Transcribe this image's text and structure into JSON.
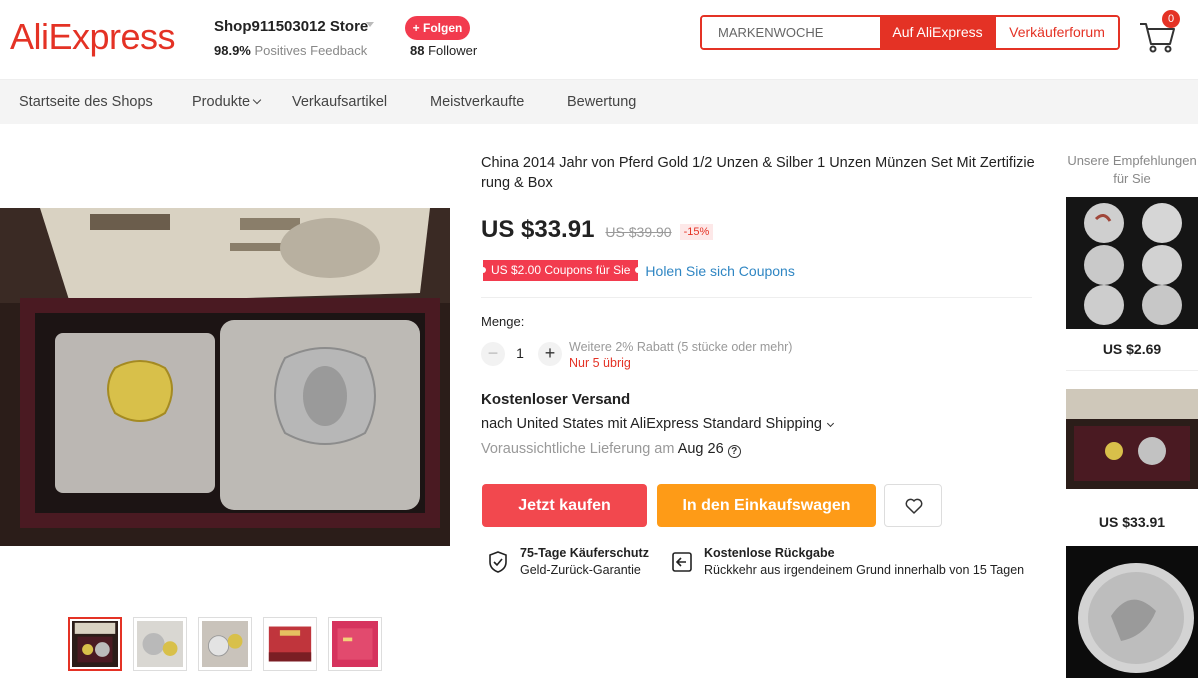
{
  "header": {
    "logo": "AliExpress",
    "store_name": "Shop911503012 Store",
    "feedback_percent": "98.9%",
    "feedback_label": "Positives Feedback",
    "follow_label": "+ Folgen",
    "follower_count": "88",
    "follower_label": "Follower",
    "search_placeholder": "MARKENWOCHE",
    "search_aliexpress_label": "Auf AliExpress",
    "search_seller_label": "Verkäuferforum",
    "cart_count": "0"
  },
  "nav": {
    "items": [
      {
        "label": "Startseite des Shops"
      },
      {
        "label": "Produkte"
      },
      {
        "label": "Verkaufsartikel"
      },
      {
        "label": "Meistverkaufte"
      },
      {
        "label": "Bewertung"
      }
    ]
  },
  "product": {
    "title": "China 2014 Jahr von Pferd Gold 1/2 Unzen & Silber 1 Unzen Münzen Set Mit Zertifizie rung & Box",
    "price": "US $33.91",
    "old_price": "US $39.90",
    "discount": "-15%",
    "coupon": "US $2.00 Coupons für Sie",
    "coupon_link": "Holen Sie sich Coupons",
    "quantity_label": "Menge:",
    "quantity": "1",
    "bulk_discount": "Weitere 2% Rabatt (5 stücke oder mehr)",
    "stock": "Nur 5 übrig",
    "shipping_title": "Kostenloser Versand",
    "shipping_to": "nach United States mit AliExpress Standard Shipping",
    "delivery_label": "Voraussichtliche Lieferung am",
    "delivery_date": "Aug 26",
    "buy_now_label": "Jetzt kaufen",
    "add_to_cart_label": "In den Einkaufswagen",
    "protection_title": "75-Tage Käuferschutz",
    "protection_sub": "Geld-Zurück-Garantie",
    "return_title": "Kostenlose Rückgabe",
    "return_sub": "Rückkehr aus irgendeinem Grund innerhalb von 15 Tagen"
  },
  "recommendations": {
    "title": "Unsere Empfehlungen für Sie",
    "items": [
      {
        "price": "US $2.69"
      },
      {
        "price": "US $33.91"
      }
    ]
  },
  "colors": {
    "brand_red": "#e43225",
    "buy_red": "#f2484e",
    "cart_orange": "#fe9b17",
    "link_blue": "#2f86c3"
  }
}
